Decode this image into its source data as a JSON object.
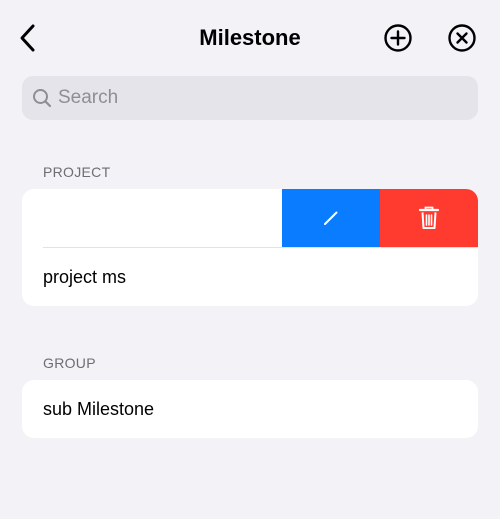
{
  "nav": {
    "title": "Milestone",
    "back_icon": "chevron-left-icon",
    "add_icon": "plus-circle-icon",
    "close_icon": "x-circle-icon"
  },
  "search": {
    "placeholder": "Search",
    "value": "",
    "icon": "magnifying-glass-icon"
  },
  "sections": {
    "project": {
      "header": "PROJECT",
      "rows": [
        {
          "label": "",
          "swipe_actions": [
            "edit",
            "delete"
          ]
        },
        {
          "label": "project ms"
        }
      ]
    },
    "group": {
      "header": "GROUP",
      "rows": [
        {
          "label": "sub Milestone"
        }
      ]
    }
  },
  "colors": {
    "background": "#f2f2f7",
    "edit_action": "#0a7cff",
    "delete_action": "#ff3b30",
    "secondary_text": "#6d6d72"
  },
  "icons": {
    "edit": "pencil-icon",
    "delete": "trash-icon"
  }
}
